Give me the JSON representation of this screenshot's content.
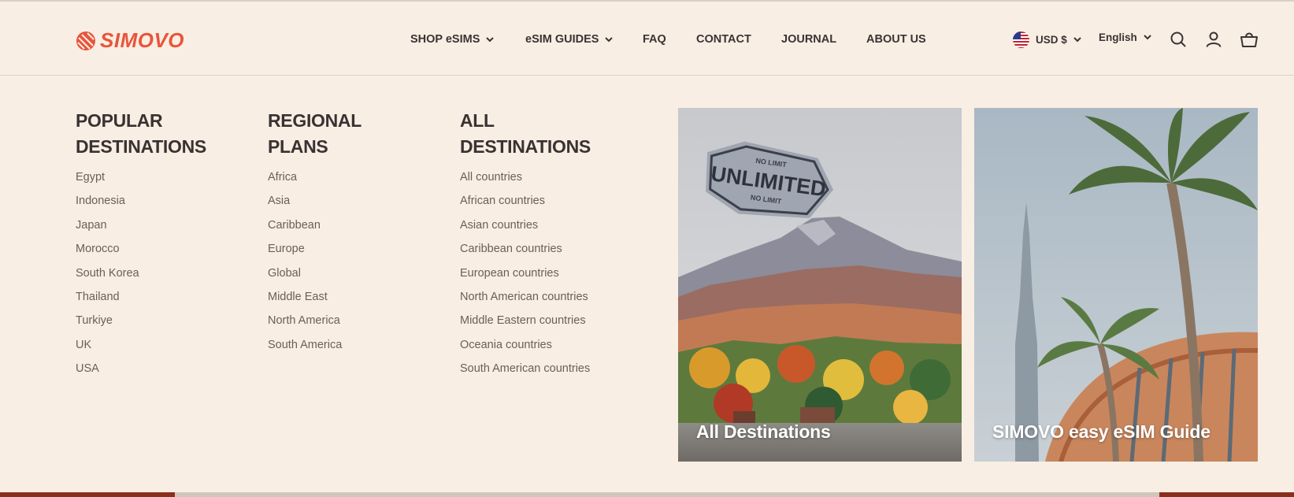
{
  "brand": {
    "name": "SIMOVO",
    "color": "#e8553a"
  },
  "nav": {
    "items": [
      {
        "label": "SHOP eSIMS",
        "dropdown": true
      },
      {
        "label": "eSIM GUIDES",
        "dropdown": true
      },
      {
        "label": "FAQ",
        "dropdown": false
      },
      {
        "label": "CONTACT",
        "dropdown": false
      },
      {
        "label": "JOURNAL",
        "dropdown": false
      },
      {
        "label": "ABOUT US",
        "dropdown": false
      }
    ]
  },
  "controls": {
    "currency": "USD $",
    "language": "English",
    "icons": [
      "search-icon",
      "account-icon",
      "cart-icon",
      "us-flag-icon"
    ]
  },
  "megamenu": {
    "columns": [
      {
        "title_line1": "POPULAR",
        "title_line2": "DESTINATIONS",
        "links": [
          "Egypt",
          "Indonesia",
          "Japan",
          "Morocco",
          "South Korea",
          "Thailand",
          "Turkiye",
          "UK",
          "USA"
        ]
      },
      {
        "title_line1": "REGIONAL",
        "title_line2": "PLANS",
        "links": [
          "Africa",
          "Asia",
          "Caribbean",
          "Europe",
          "Global",
          "Middle East",
          "North America",
          "South America"
        ]
      },
      {
        "title_line1": "ALL",
        "title_line2": "DESTINATIONS",
        "links": [
          "All countries",
          "African countries",
          "Asian countries",
          "Caribbean countries",
          "European countries",
          "North American countries",
          "Middle Eastern countries",
          "Oceania countries",
          "South American countries"
        ]
      }
    ],
    "cards": [
      {
        "label": "All Destinations",
        "badge_main": "UNLIMITED",
        "badge_top": "NO LIMIT",
        "badge_bottom": "NO LIMIT"
      },
      {
        "label": "SIMOVO easy eSIM Guide"
      }
    ]
  }
}
